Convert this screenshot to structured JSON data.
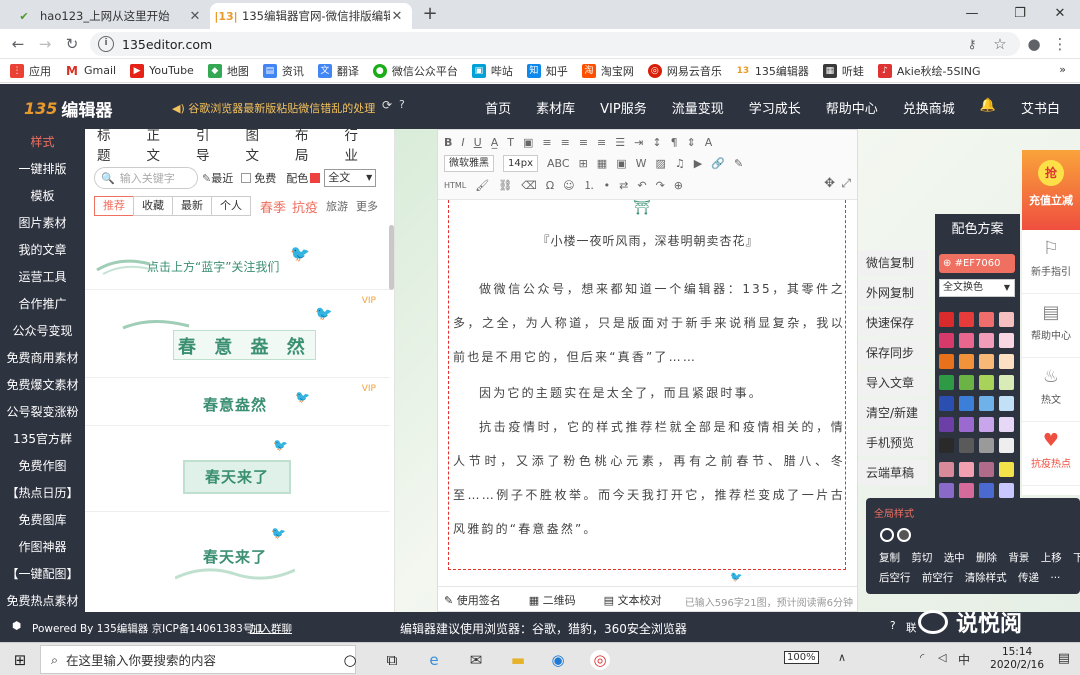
{
  "browser": {
    "tabs": [
      {
        "title": "hao123_上网从这里开始",
        "active": false
      },
      {
        "title": "135编辑器官网-微信排版编辑器",
        "active": true
      }
    ],
    "url": "135editor.com",
    "bookmarks": [
      "应用",
      "Gmail",
      "YouTube",
      "地图",
      "资讯",
      "翻译",
      "微信公众平台",
      "哔站",
      "知乎",
      "淘宝网",
      "网易云音乐",
      "135编辑器",
      "听蛙",
      "Akie秋绘-5SING"
    ],
    "more": "»"
  },
  "header": {
    "logo": "编辑器",
    "logo_number": "135",
    "notice": "◀) 谷歌浏览器最新版粘贴微信错乱的处理",
    "nav": [
      "首页",
      "素材库",
      "VIP服务",
      "流量变现",
      "学习成长",
      "帮助中心",
      "兑换商城"
    ],
    "user": "艾书白"
  },
  "leftnav": [
    "样式",
    "一键排版",
    "模板",
    "图片素材",
    "我的文章",
    "运营工具",
    "合作推广",
    "公众号变现",
    "免费商用素材",
    "免费爆文素材",
    "公号裂变涨粉",
    "135官方群",
    "免费作图",
    "【热点日历】",
    "免费图库",
    "作图神器",
    "【一键配图】",
    "免费热点素材"
  ],
  "stylepanel": {
    "categories": [
      "标题",
      "正文",
      "引导",
      "图文",
      "布局",
      "行业"
    ],
    "search_placeholder": "输入关键字",
    "recent": "最近",
    "free": "免费",
    "color_label": "配色",
    "color_select": "全文",
    "filters": [
      "推荐",
      "收藏",
      "最新",
      "个人"
    ],
    "hot1": "春季",
    "hot2": "抗疫",
    "travel": "旅游",
    "more": "更多",
    "cards": [
      {
        "text": "点击上方“蓝字”关注我们"
      },
      {
        "text": "春 意 盎 然",
        "vip": "VIP"
      },
      {
        "text": "春意盎然",
        "vip": "VIP"
      },
      {
        "text": "春天来了"
      },
      {
        "text": "春天来了"
      }
    ]
  },
  "editor": {
    "font": "微软雅黑",
    "size": "14px",
    "heading": "『小楼一夜听风雨，深巷明朝卖杏花』",
    "paragraphs": [
      "做微信公众号，想来都知道一个编辑器：135，其零件之多，之全，为人称道，只是版面对于新手来说稍显复杂，我以前也是不用它的，但后来“真香”了……",
      "因为它的主题实在是太全了，而且紧跟时事。",
      "抗击疫情时，它的样式推荐栏就全部是和疫情相关的，情人节时，又添了粉色桃心元素，再有之前春节、腊八、冬至……例子不胜枚举。而今天我打开它，推荐栏变成了一片古风雅韵的“春意盎然”。"
    ],
    "footer": {
      "signature": "使用签名",
      "qrcode": "二维码",
      "proofread": "文本校对",
      "wordcount": "已输入596字21图，预计阅读需6分钟"
    }
  },
  "actions": [
    "微信复制",
    "外网复制",
    "快速保存",
    "保存同步",
    "导入文章",
    "清空/新建",
    "手机预览",
    "云端草稿"
  ],
  "colorpanel": {
    "title": "配色方案",
    "current": "#EF7060",
    "mode": "全文换色",
    "swatches": [
      "#d92b2b",
      "#e63b3b",
      "#f06d6d",
      "#f7c0c0",
      "#d63a6a",
      "#e9668f",
      "#f19cb8",
      "#f8d6e2",
      "#e8711c",
      "#f2923b",
      "#f7b878",
      "#fbe0c4",
      "#2f9a45",
      "#6ab344",
      "#a8d25a",
      "#d9ecb8",
      "#2b4fb0",
      "#3b7fd9",
      "#6fb2ea",
      "#c2e1f7",
      "#6b3fa6",
      "#9b6ad0",
      "#c9a6ec",
      "#e7d8f7",
      "#2a2a2a",
      "#5a5a5a",
      "#9a9a9a",
      "#eeeeee"
    ],
    "swatches2": [
      "#d98a9a",
      "#f0a0b0",
      "#b06a8a",
      "#f4e24a",
      "#8a6ac8",
      "#d66a9a",
      "#4a6ad0",
      "#c8c8ff"
    ]
  },
  "rightbar": {
    "promo": "充值立减",
    "promo_badge": "抢",
    "items": [
      "新手指引",
      "帮助中心",
      "热文",
      "抗疫热点"
    ]
  },
  "globalstyle": {
    "title": "全局样式",
    "row1": [
      "复制",
      "剪切",
      "选中",
      "删除",
      "背景",
      "上移",
      "下移"
    ],
    "row2": [
      "后空行",
      "前空行",
      "清除样式",
      "传递",
      "···"
    ]
  },
  "footer": {
    "powered": "Powered By 135编辑器  京ICP备14061383号-1",
    "join": "加入群聊",
    "browser_tip": "编辑器建议使用浏览器：谷歌，猎豹，360安全浏览器",
    "right": "联"
  },
  "watermark": "说悦阅",
  "taskbar": {
    "search": "在这里输入你要搜索的内容",
    "battery": "100%",
    "ime": "中",
    "time": "15:14",
    "date": "2020/2/16"
  }
}
